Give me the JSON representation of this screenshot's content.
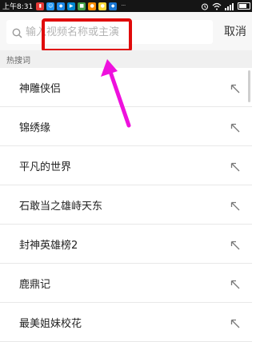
{
  "status_bar": {
    "time": "上午8:31",
    "battery_level": 0.8,
    "notification_icons": [
      {
        "name": "red-app-icon",
        "color": "#e53935",
        "glyph": "▮"
      },
      {
        "name": "smiley-app-icon",
        "color": "#2196f3",
        "glyph": "☺"
      },
      {
        "name": "blue-app-icon",
        "color": "#1e88e5",
        "glyph": "◆"
      },
      {
        "name": "video-app-icon",
        "color": "#0288d1",
        "glyph": "▶"
      },
      {
        "name": "green-app-icon",
        "color": "#43a047",
        "glyph": "■"
      },
      {
        "name": "orange-app-icon",
        "color": "#fb8c00",
        "glyph": "●"
      },
      {
        "name": "yellow-app-icon",
        "color": "#fdd835",
        "glyph": "●"
      },
      {
        "name": "blue-app-icon-2",
        "color": "#1976d2",
        "glyph": "◆"
      },
      {
        "name": "more-dots-icon",
        "color": "#151515",
        "glyph": "···"
      }
    ]
  },
  "search": {
    "placeholder": "输入视频名称或主演",
    "value": "",
    "cancel_label": "取消"
  },
  "hot": {
    "title": "热搜词",
    "items": [
      {
        "label": "神雕侠侣"
      },
      {
        "label": "锦绣缘"
      },
      {
        "label": "平凡的世界"
      },
      {
        "label": "石敢当之雄峙天东"
      },
      {
        "label": "封神英雄榜2"
      },
      {
        "label": "鹿鼎记"
      },
      {
        "label": "最美姐妹校花"
      }
    ]
  },
  "colors": {
    "highlight": "#e00b0b",
    "annotation_arrow": "#ee11dd"
  }
}
